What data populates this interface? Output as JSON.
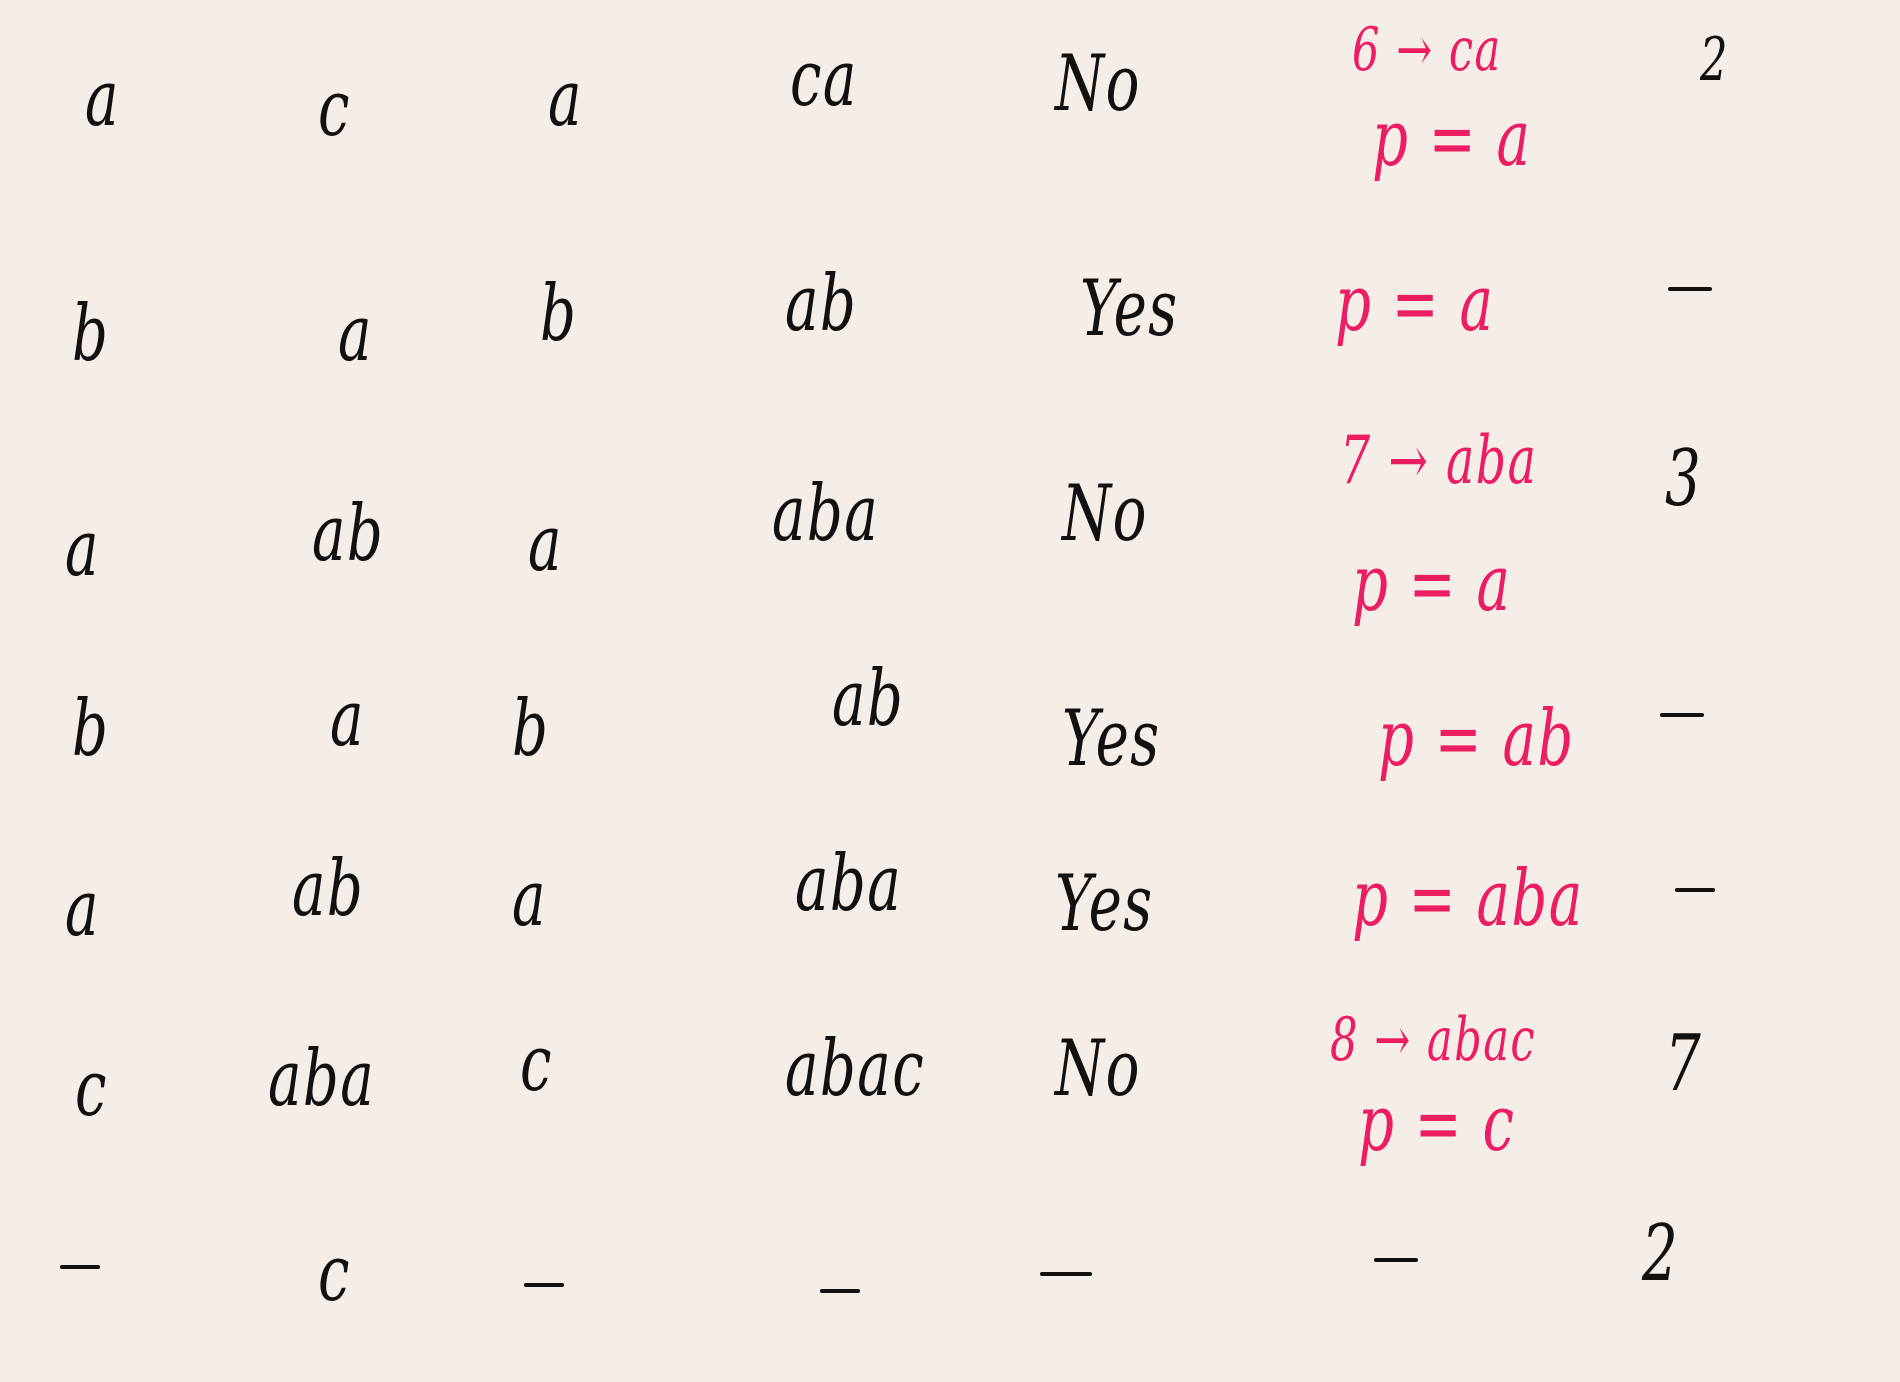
{
  "colors": {
    "background": "#f5ede8",
    "ink": "#111111",
    "annotation": "#ec1e63"
  },
  "rows": [
    {
      "c1": "a",
      "c2": "c",
      "c3": "a",
      "c4": "ca",
      "c5": "No",
      "c6_top": "6 → ca",
      "c6_bottom": "p = a",
      "c7": "2"
    },
    {
      "c1": "b",
      "c2": "a",
      "c3": "b",
      "c4": "ab",
      "c5": "Yes",
      "c6_top": "",
      "c6_bottom": "p = a",
      "c7": "—"
    },
    {
      "c1": "a",
      "c2": "ab",
      "c3": "a",
      "c4": "aba",
      "c5": "No",
      "c6_top": "7 → aba",
      "c6_bottom": "p = a",
      "c7": "3"
    },
    {
      "c1": "b",
      "c2": "a",
      "c3": "b",
      "c4": "ab",
      "c5": "Yes",
      "c6_top": "",
      "c6_bottom": "p = ab",
      "c7": "—"
    },
    {
      "c1": "a",
      "c2": "ab",
      "c3": "a",
      "c4": "aba",
      "c5": "Yes",
      "c6_top": "",
      "c6_bottom": "p = aba",
      "c7": "—"
    },
    {
      "c1": "c",
      "c2": "aba",
      "c3": "c",
      "c4": "abac",
      "c5": "No",
      "c6_top": "8 → abac",
      "c6_bottom": "p = c",
      "c7": "7"
    },
    {
      "c1": "—",
      "c2": "c",
      "c3": "—",
      "c4": "—",
      "c5": "—",
      "c6_top": "",
      "c6_bottom": "—",
      "c7": "2"
    }
  ]
}
